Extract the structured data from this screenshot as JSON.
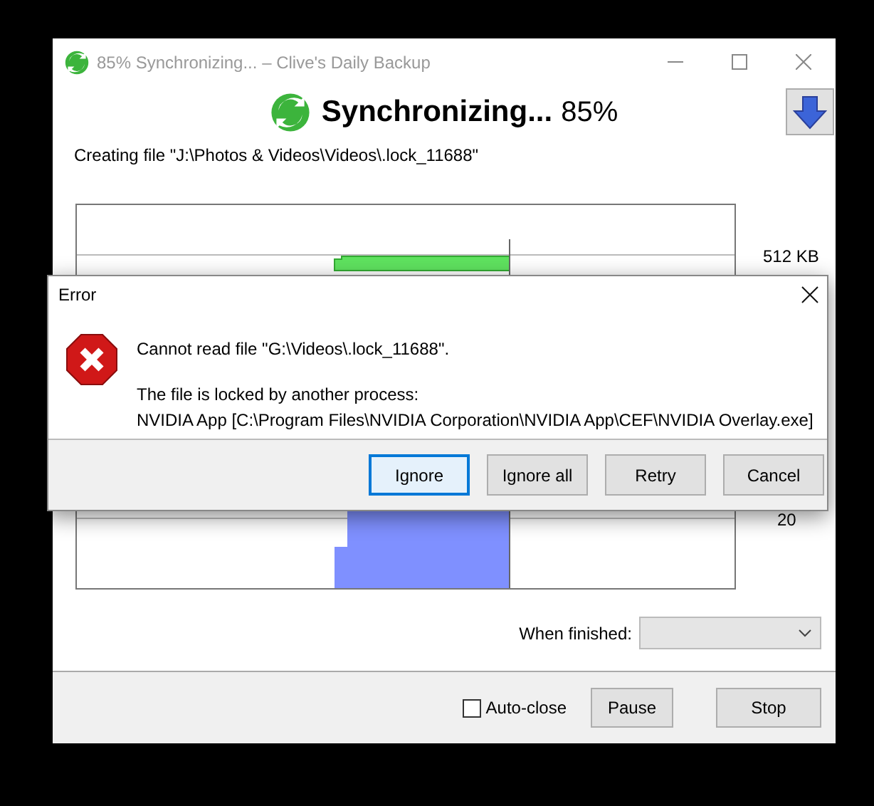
{
  "window": {
    "title": "85% Synchronizing... – Clive's Daily Backup"
  },
  "header": {
    "status": "Synchronizing...",
    "percent": "85%"
  },
  "current_action": "Creating file \"J:\\Photos & Videos\\Videos\\.lock_11688\"",
  "graph": {
    "labels": [
      "512 KB",
      "20"
    ]
  },
  "when_finished": {
    "label": "When finished:",
    "disabled": true
  },
  "auto_close": {
    "label": "Auto-close",
    "checked": false
  },
  "buttons": [
    "Pause",
    "Stop"
  ],
  "error_dialog": {
    "title": "Error",
    "message": "Cannot read file \"G:\\Videos\\.lock_11688\".",
    "details": [
      "The file is locked by another process:",
      "NVIDIA App [C:\\Program Files\\NVIDIA Corporation\\NVIDIA App\\CEF\\NVIDIA Overlay.exe]"
    ],
    "buttons": [
      {
        "label": "Ignore",
        "default": true
      },
      {
        "label": "Ignore all",
        "default": false
      },
      {
        "label": "Retry",
        "default": false
      },
      {
        "label": "Cancel",
        "default": false
      }
    ]
  }
}
